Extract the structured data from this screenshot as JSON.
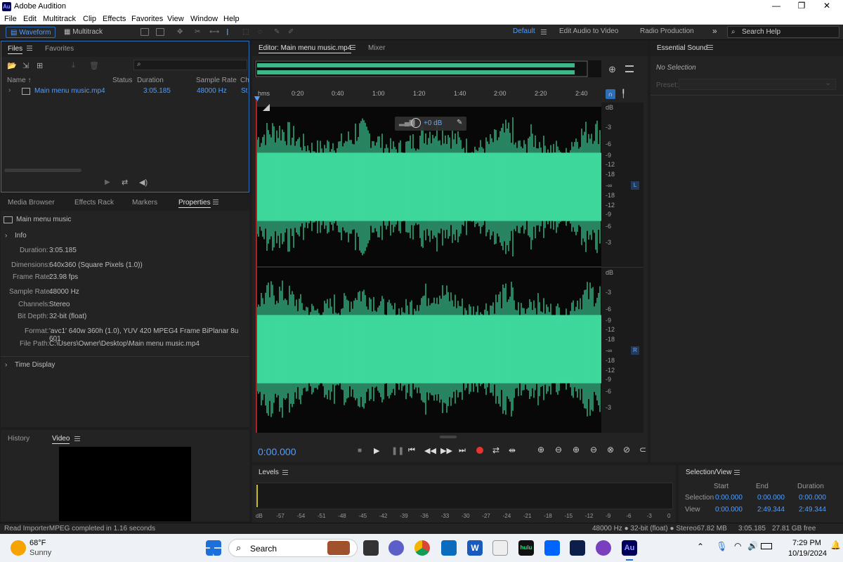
{
  "window": {
    "app_title": "Adobe Audition",
    "logo_text": "Au",
    "min": "—",
    "max": "❐",
    "close": "✕"
  },
  "menu": [
    "File",
    "Edit",
    "Multitrack",
    "Clip",
    "Effects",
    "Favorites",
    "View",
    "Window",
    "Help"
  ],
  "toolbar": {
    "waveform_label": "Waveform",
    "multitrack_label": "Multitrack",
    "workspaces": [
      "Default",
      "Edit Audio to Video",
      "Radio Production"
    ],
    "more": "»",
    "search_placeholder": "Search Help"
  },
  "files_panel": {
    "tabs": [
      "Files",
      "Favorites"
    ],
    "columns": [
      "Name",
      "Status",
      "Duration",
      "Sample Rate",
      "Ch"
    ],
    "row": {
      "name": "Main menu music.mp4",
      "duration": "3:05.185",
      "sample_rate": "48000 Hz",
      "ch": "St"
    },
    "search_icon": "🔍"
  },
  "props_panel": {
    "tabs": [
      "Media Browser",
      "Effects Rack",
      "Markers",
      "Properties"
    ],
    "item_name": "Main menu music",
    "section_info": "Info",
    "fields": [
      {
        "label": "Duration:",
        "value": "3:05.185"
      },
      {
        "label": "Dimensions:",
        "value": "640x360 (Square Pixels (1.0))"
      },
      {
        "label": "Frame Rate:",
        "value": "23.98 fps"
      },
      {
        "label": "Sample Rate:",
        "value": "48000 Hz"
      },
      {
        "label": "Channels:",
        "value": "Stereo"
      },
      {
        "label": "Bit Depth:",
        "value": "32-bit (float)"
      },
      {
        "label": "Format:",
        "value": "'avc1' 640w 360h (1.0), YUV 420 MPEG4 Frame BiPlanar 8u 601"
      },
      {
        "label": "File Path:",
        "value": "C:\\Users\\Owner\\Desktop\\Main menu music.mp4"
      }
    ],
    "section_time": "Time Display"
  },
  "video_panel": {
    "tabs": [
      "History",
      "Video"
    ]
  },
  "editor": {
    "tabs": [
      "Editor: Main menu music.mp4",
      "Mixer"
    ],
    "time_unit": "hms",
    "ticks": [
      "0:20",
      "0:40",
      "1:00",
      "1:20",
      "1:40",
      "2:00",
      "2:20",
      "2:40"
    ],
    "db_label": "dB",
    "db_ticks": [
      "-3",
      "-6",
      "-9",
      "-12",
      "-18",
      "-∞",
      "-18",
      "-12",
      "-9",
      "-6",
      "-3"
    ],
    "channel_left": "L",
    "channel_right": "R",
    "hud_gain": "+0 dB",
    "current_time": "0:00.000"
  },
  "essential_sound": {
    "title": "Essential Sound",
    "no_selection": "No Selection",
    "preset_label": "Preset:"
  },
  "levels": {
    "title": "Levels",
    "scale": [
      "dB",
      "-57",
      "-54",
      "-51",
      "-48",
      "-45",
      "-42",
      "-39",
      "-36",
      "-33",
      "-30",
      "-27",
      "-24",
      "-21",
      "-18",
      "-15",
      "-12",
      "-9",
      "-6",
      "-3",
      "0"
    ]
  },
  "selection_view": {
    "title": "Selection/View",
    "headers": [
      "Start",
      "End",
      "Duration"
    ],
    "rows": [
      {
        "label": "Selection",
        "start": "0:00.000",
        "end": "0:00.000",
        "duration": "0:00.000"
      },
      {
        "label": "View",
        "start": "0:00.000",
        "end": "2:49.344",
        "duration": "2:49.344"
      }
    ]
  },
  "status": {
    "message": "Read ImporterMPEG completed in 1.16 seconds",
    "format": "48000 Hz ● 32-bit (float) ● Stereo",
    "size": "67.82 MB",
    "duration": "3:05.185",
    "free": "27.81 GB free"
  },
  "taskbar": {
    "temp": "68°F",
    "weather": "Sunny",
    "search": "Search",
    "time": "7:29 PM",
    "date": "10/19/2024",
    "au_label": "Au",
    "hulu_label": "hulu",
    "word_label": "W"
  },
  "colors": {
    "wave": "#3fd79b",
    "accent": "#4f9eff",
    "record": "#e8342f"
  }
}
